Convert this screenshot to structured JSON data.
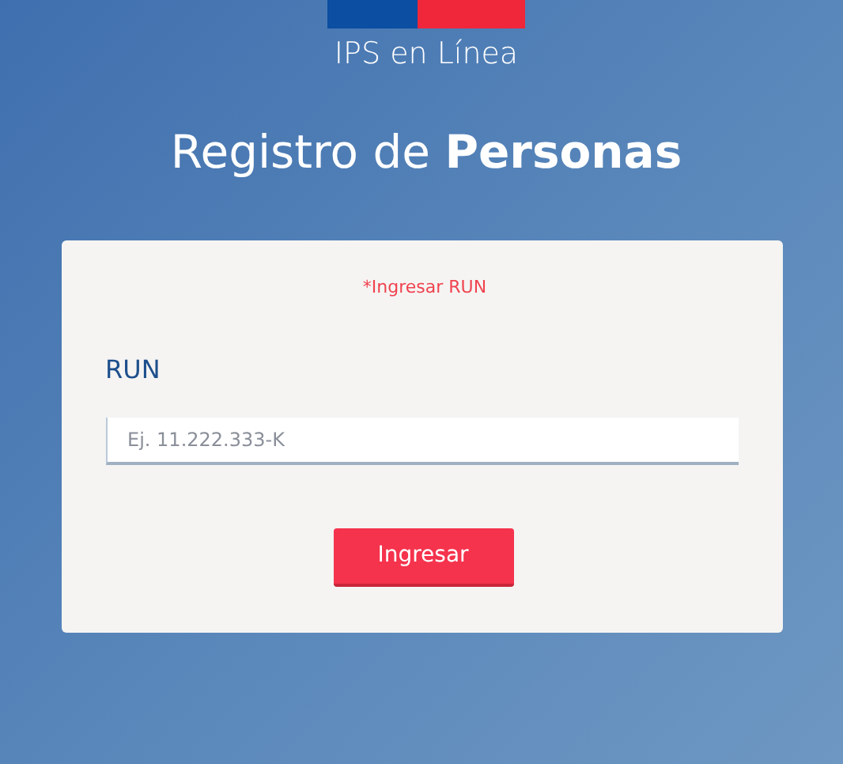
{
  "brand": "IPS en Línea",
  "title": "Registro de **Personas**",
  "form": {
    "error": "*Ingresar RUN",
    "label": "RUN",
    "field": {
      "placeholder": "Ej. 11.222.333-K"
    },
    "button": "Ingresar"
  }
}
